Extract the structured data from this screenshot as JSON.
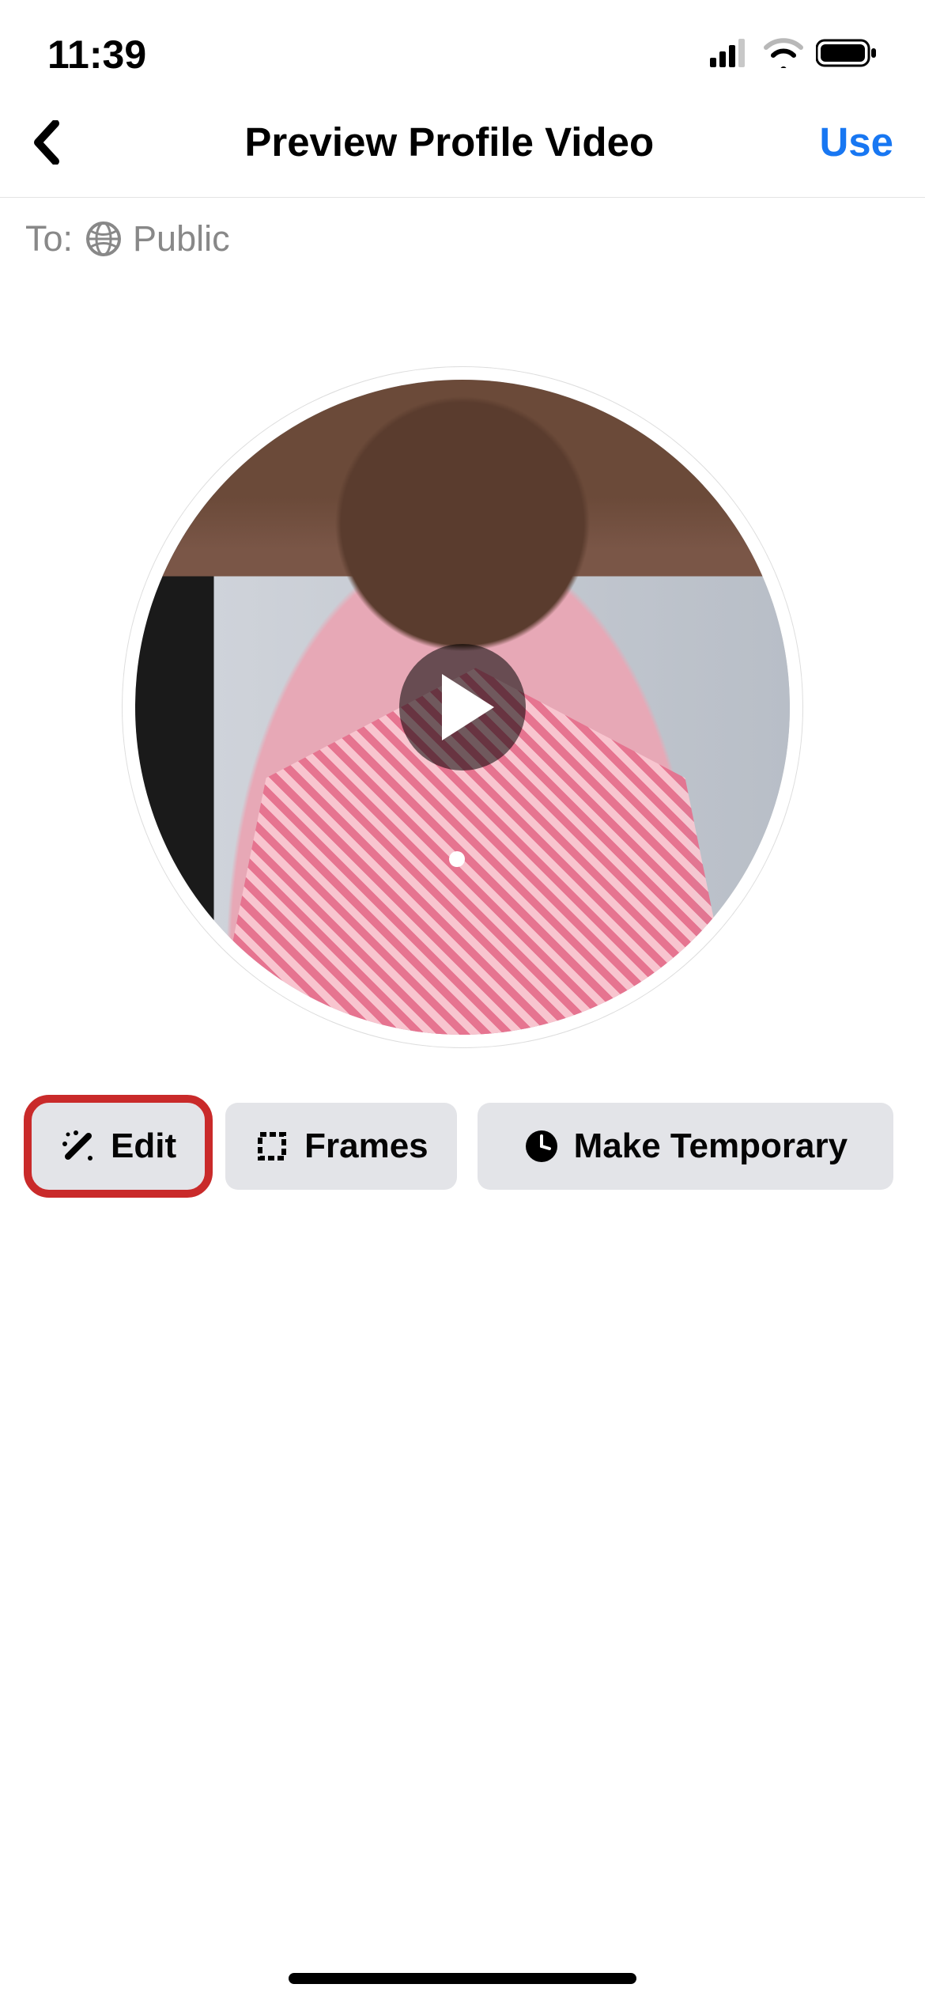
{
  "status": {
    "time": "11:39"
  },
  "nav": {
    "title": "Preview Profile Video",
    "use_label": "Use"
  },
  "audience": {
    "to_label": "To:",
    "value": "Public"
  },
  "actions": {
    "edit": "Edit",
    "frames": "Frames",
    "make_temporary": "Make Temporary"
  },
  "highlighted_action": "edit"
}
